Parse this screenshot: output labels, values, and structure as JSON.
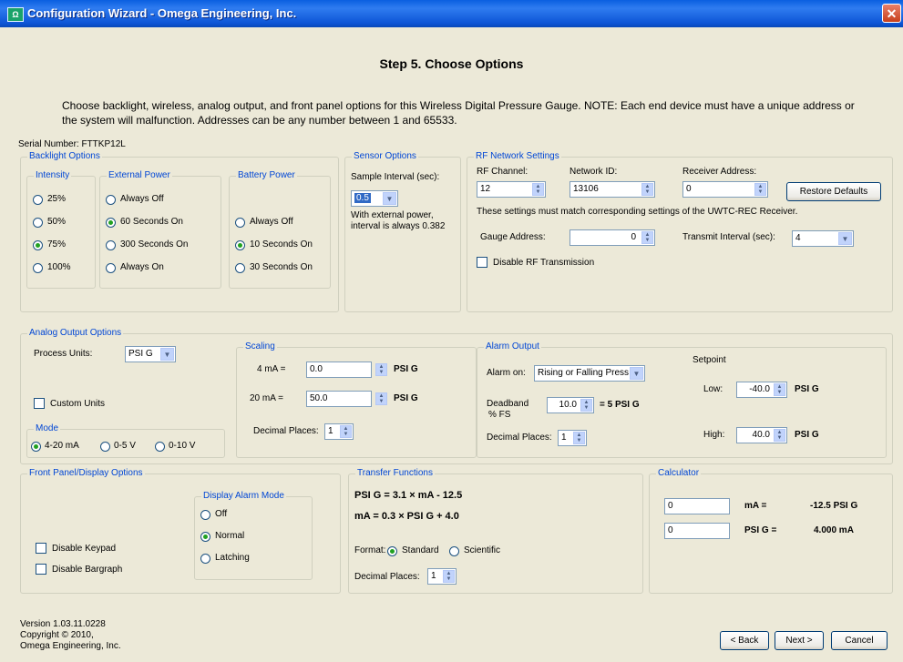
{
  "window": {
    "title": "Configuration Wizard - Omega Engineering, Inc.",
    "icon": "omega-app-icon",
    "close_icon": "close-icon"
  },
  "step_title": "Step 5.  Choose Options",
  "description": "Choose backlight, wireless, analog output, and front panel options for this Wireless Digital Pressure Gauge.  NOTE: Each end device must have a unique address or the system will malfunction.  Addresses can be any number between 1 and 65533.",
  "serial_number": "Serial Number: FTTKP12L",
  "backlight": {
    "legend": "Backlight Options",
    "intensity": {
      "legend": "Intensity",
      "options": [
        "25%",
        "50%",
        "75%",
        "100%"
      ],
      "selected": "75%"
    },
    "external_power": {
      "legend": "External Power",
      "options": [
        "Always Off",
        "60 Seconds On",
        "300 Seconds On",
        "Always On"
      ],
      "selected": "60 Seconds On"
    },
    "battery_power": {
      "legend": "Battery Power",
      "options": [
        "Always Off",
        "10 Seconds On",
        "30 Seconds On"
      ],
      "selected": "10 Seconds On"
    }
  },
  "sensor": {
    "legend": "Sensor Options",
    "sample_interval_label": "Sample Interval (sec):",
    "sample_interval_value": "0.5",
    "note": "With external power, interval is always 0.382"
  },
  "rf": {
    "legend": "RF Network Settings",
    "channel_label": "RF Channel:",
    "channel_value": "12",
    "network_id_label": "Network ID:",
    "network_id_value": "13106",
    "receiver_address_label": "Receiver Address:",
    "receiver_address_value": "0",
    "restore_button": "Restore Defaults",
    "note": "These settings must match corresponding settings of the UWTC-REC Receiver.",
    "gauge_address_label": "Gauge Address:",
    "gauge_address_value": "0",
    "transmit_interval_label": "Transmit Interval (sec):",
    "transmit_interval_value": "4",
    "disable_rf_label": "Disable RF Transmission"
  },
  "analog": {
    "legend": "Analog Output Options",
    "process_units_label": "Process Units:",
    "process_units_value": "PSI G",
    "custom_units_label": "Custom Units",
    "mode": {
      "legend": "Mode",
      "options": [
        "4-20 mA",
        "0-5 V",
        "0-10 V"
      ],
      "selected": "4-20 mA"
    },
    "scaling": {
      "legend": "Scaling",
      "ma4_label": "4 mA =",
      "ma4_value": "0.0",
      "ma4_unit": "PSI G",
      "ma20_label": "20 mA =",
      "ma20_value": "50.0",
      "ma20_unit": "PSI G",
      "decimal_label": "Decimal Places:",
      "decimal_value": "1"
    },
    "alarm": {
      "legend": "Alarm Output",
      "alarm_on_label": "Alarm on:",
      "alarm_on_value": "Rising or Falling Press",
      "deadband_label": "Deadband",
      "deadband_sub": "% FS",
      "deadband_value": "10.0",
      "deadband_result": "= 5  PSI G",
      "decimal_label": "Decimal Places:",
      "decimal_value": "1",
      "setpoint_label": "Setpoint",
      "low_label": "Low:",
      "low_value": "-40.0",
      "low_unit": "PSI G",
      "high_label": "High:",
      "high_value": "40.0",
      "high_unit": "PSI G"
    }
  },
  "front_panel": {
    "legend": "Front Panel/Display Options",
    "disable_keypad": "Disable Keypad",
    "disable_bargraph": "Disable Bargraph",
    "alarm_mode": {
      "legend": "Display Alarm Mode",
      "options": [
        "Off",
        "Normal",
        "Latching"
      ],
      "selected": "Normal"
    }
  },
  "transfer": {
    "legend": "Transfer Functions",
    "eq1": "PSI G = 3.1 × mA - 12.5",
    "eq2": "mA = 0.3 × PSI G + 4.0",
    "format_label": "Format:",
    "format_options": [
      "Standard",
      "Scientific"
    ],
    "format_selected": "Standard",
    "decimal_label": "Decimal Places:",
    "decimal_value": "1"
  },
  "calculator": {
    "legend": "Calculator",
    "input1": "0",
    "label1": "mA =",
    "result1": "-12.5 PSI G",
    "input2": "0",
    "label2": "PSI G =",
    "result2": "4.000 mA"
  },
  "version": {
    "line1": "Version 1.03.11.0228",
    "line2": "Copyright © 2010,",
    "line3": "Omega Engineering, Inc."
  },
  "buttons": {
    "back": "< Back",
    "next": "Next >",
    "cancel": "Cancel"
  }
}
